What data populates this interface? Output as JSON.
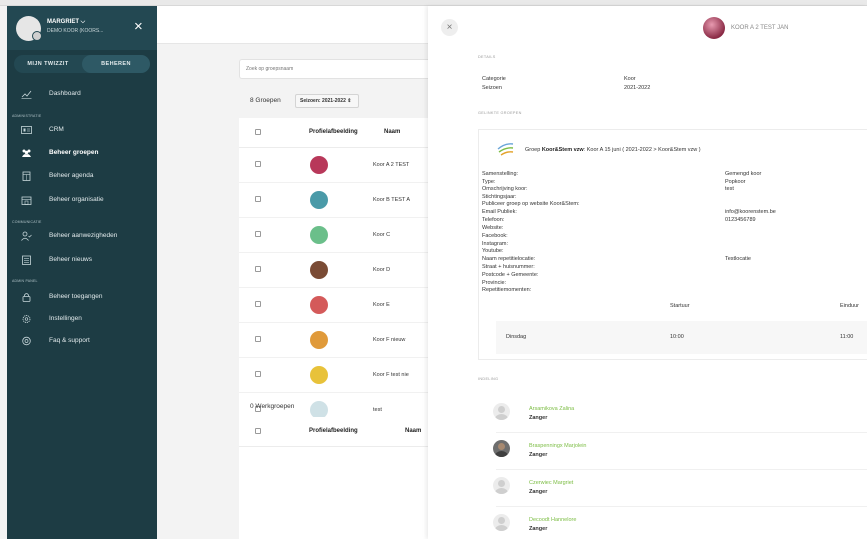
{
  "colors": {
    "sidebar_bg": "#1d3c44",
    "accent_green": "#7cbd44",
    "link_green": "#7cbd44"
  },
  "sidebar": {
    "user_name": "MARGRIET ⌵",
    "user_org": "DEMO KOOR (KOORS...",
    "close_icon": "×",
    "tabs": [
      {
        "label": "MIJN TWIZZIT",
        "active": false
      },
      {
        "label": "BEHEREN",
        "active": true
      }
    ],
    "sections": {
      "administratie": "ADMINISTRATIE",
      "communicatie": "COMMUNICATIE",
      "admin_panel": "ADMIN PANEL"
    },
    "items": [
      {
        "label": "Dashboard",
        "icon": "chart-icon"
      },
      {
        "label": "CRM",
        "icon": "id-card-icon"
      },
      {
        "label": "Beheer groepen",
        "icon": "users-icon",
        "active": true
      },
      {
        "label": "Beheer agenda",
        "icon": "calendar-icon"
      },
      {
        "label": "Beheer organisatie",
        "icon": "building-icon"
      },
      {
        "label": "Beheer aanwezigheden",
        "icon": "user-check-icon"
      },
      {
        "label": "Beheer nieuws",
        "icon": "newspaper-icon"
      },
      {
        "label": "Beheer toegangen",
        "icon": "lock-icon"
      },
      {
        "label": "Instellingen",
        "icon": "gear-icon"
      },
      {
        "label": "Faq & support",
        "icon": "support-icon"
      }
    ]
  },
  "main": {
    "search_placeholder": "Zoek op groepsnaam",
    "group_count": "8 Groepen",
    "season_select": "Seizoen: 2021-2022 ⇕",
    "columns": {
      "picture": "Profielafbeelding",
      "name": "Naam"
    },
    "groups": [
      {
        "name": "Koor A 2 TEST",
        "pic_color": "#b8385a"
      },
      {
        "name": "Koor B TEST A",
        "pic_color": "#4a9aa8"
      },
      {
        "name": "Koor C",
        "pic_color": "#6bbf8a"
      },
      {
        "name": "Koor D",
        "pic_color": "#7a4b35"
      },
      {
        "name": "Koor E",
        "pic_color": "#d45a5a"
      },
      {
        "name": "Koor F nieuw",
        "pic_color": "#e09a3a"
      },
      {
        "name": "Koor F test nie",
        "pic_color": "#e8c23a"
      },
      {
        "name": "test",
        "pic_color": "#cfe1e6"
      }
    ],
    "work_group_count": "0 Werkgroepen",
    "work_columns": {
      "picture": "Profielafbeelding",
      "name": "Naam"
    }
  },
  "panel": {
    "close_icon": "×",
    "title": "KOOR A 2 TEST JAN",
    "details_label": "DETAILS",
    "details": [
      {
        "key": "Categorie",
        "value": "Koor"
      },
      {
        "key": "Seizoen",
        "value": "2021-2022"
      }
    ],
    "linked_label": "GELINKTE GROEPEN",
    "linked_group": {
      "prefix": "Groep",
      "org": "Koor&Stem vzw",
      "rest": ": Koor A 15 juni ( 2021-2022 > Koor&Stem vzw )"
    },
    "linked_fields": [
      {
        "key": "Samenstelling:",
        "value": "Gemengd koor"
      },
      {
        "key": "Type:",
        "value": "Popkoor"
      },
      {
        "key": "Omschrijving koor:",
        "value": "test"
      },
      {
        "key": "Stichtingsjaar:",
        "value": ""
      },
      {
        "key": "Publiceer groep op website Koor&Stem:",
        "value": ""
      },
      {
        "key": "Email Publiek:",
        "value": "info@koorenstem.be"
      },
      {
        "key": "Telefoon:",
        "value": "0123456789"
      },
      {
        "key": "Website:",
        "value": ""
      },
      {
        "key": "Facebook:",
        "value": ""
      },
      {
        "key": "Instagram:",
        "value": ""
      },
      {
        "key": "Youtube:",
        "value": ""
      },
      {
        "key": "Naam repetitielocatie:",
        "value": "Testlocatie"
      },
      {
        "key": "Straat + huisnummer:",
        "value": ""
      },
      {
        "key": "Postcode + Gemeente:",
        "value": ""
      },
      {
        "key": "Provincie:",
        "value": ""
      },
      {
        "key": "Repetitiemomenten:",
        "value": ""
      }
    ],
    "schedule_headers": {
      "start": "Startuur",
      "end": "Einduur"
    },
    "schedule": {
      "day": "Dinsdag",
      "start": "10:00",
      "end": "11:00"
    },
    "roster_label": "INDELING",
    "members": [
      {
        "name": "Arsamikova Zalina",
        "role": "Zanger"
      },
      {
        "name": "Braspenningx Marjolein",
        "role": "Zanger"
      },
      {
        "name": "Czerwiec Margriet",
        "role": "Zanger"
      },
      {
        "name": "Decoodt Hannelore",
        "role": "Zanger"
      }
    ]
  }
}
